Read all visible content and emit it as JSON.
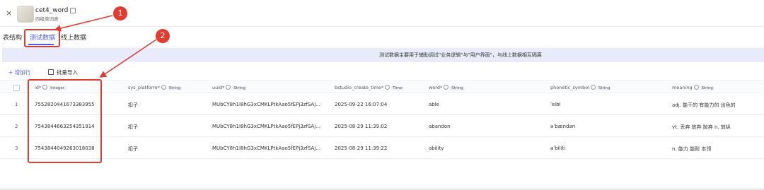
{
  "header": {
    "close_icon": "×",
    "db_name": "cet4_word",
    "db_subtitle": "四级单词表"
  },
  "tabs": [
    {
      "label": "表结构"
    },
    {
      "label": "测试数据"
    },
    {
      "label": "线上数据"
    }
  ],
  "banner": {
    "text": "测试数据主要用于辅助调试\"业务逻辑\"与\"用户界面\"，与线上数据相互隔离"
  },
  "toolbar": {
    "add_row": "增加行",
    "batch_import": "批量导入"
  },
  "table": {
    "columns": [
      {
        "name": "id*",
        "type": "Integer"
      },
      {
        "name": "sys_platform*",
        "type": "String"
      },
      {
        "name": "uuid*",
        "type": "String"
      },
      {
        "name": "bstudio_create_time*",
        "type": "Time"
      },
      {
        "name": "word*",
        "type": "String"
      },
      {
        "name": "phonetic_symbol",
        "type": "String"
      },
      {
        "name": "meaning",
        "type": "String"
      }
    ],
    "rows": [
      {
        "n": "1",
        "id": "7552820441673383955",
        "sys_platform": "扣子",
        "uuid": "MUbCY8h1I8hG3xCMKLPtkAao5fEPj3zfSAj…",
        "time": "2025-09-22 16:07:04",
        "word": "able",
        "phonetic": "ˈeibl",
        "meaning": "adj. 能干的 有能力的 出色的"
      },
      {
        "n": "2",
        "id": "7543844663254351914",
        "sys_platform": "扣子",
        "uuid": "MUbCY8h1I8hG3xCMKLPtkAao5fEPj3zfSAj…",
        "time": "2025-08-29 11:39:02",
        "word": "abandon",
        "phonetic": "əˈbændən",
        "meaning": "vt. 丢弃 放弃 抛弃 n. 放纵"
      },
      {
        "n": "3",
        "id": "7543844049263018038",
        "sys_platform": "扣子",
        "uuid": "MUbCY8h1I8hG3xCMKLPtkAao5fEPj3zfSAj…",
        "time": "2025-08-29 11:39:22",
        "word": "ability",
        "phonetic": "əˈbiliti",
        "meaning": "n. 能力 能耐 本领"
      }
    ]
  },
  "annotations": {
    "callout_1": "1",
    "callout_2": "2",
    "color": "#e23b30"
  },
  "colors": {
    "accent": "#4e5fe8",
    "banner_bg": "#e9ebfb"
  }
}
